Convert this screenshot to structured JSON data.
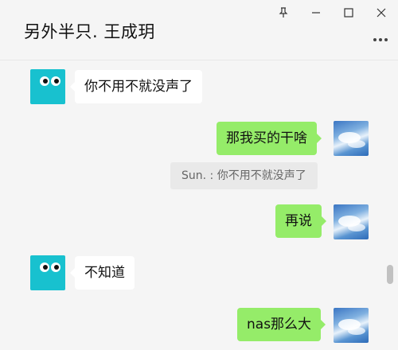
{
  "window": {
    "title": "另外半只. 王成玥",
    "pin_icon": "pin-icon",
    "minimize_icon": "minimize-icon",
    "maximize_icon": "maximize-icon",
    "close_icon": "close-icon",
    "more_icon": "more-icon"
  },
  "messages": [
    {
      "side": "left",
      "text": "你不用不就没声了",
      "avatar": "cartoon-eyes-avatar"
    },
    {
      "side": "right",
      "text": "那我买的干啥",
      "avatar": "sky-avatar"
    },
    {
      "side": "right",
      "quote": "Sun. : 你不用不就没声了"
    },
    {
      "side": "right",
      "text": "再说",
      "avatar": "sky-avatar"
    },
    {
      "side": "left",
      "text": "不知道",
      "avatar": "cartoon-eyes-avatar"
    },
    {
      "side": "right",
      "text": "nas那么大",
      "avatar": "sky-avatar"
    }
  ],
  "colors": {
    "background": "#f5f5f5",
    "self_bubble": "#95ec69",
    "other_bubble": "#ffffff",
    "quote_bg": "#e9e9e9",
    "avatar_cyan": "#18c1cf"
  }
}
